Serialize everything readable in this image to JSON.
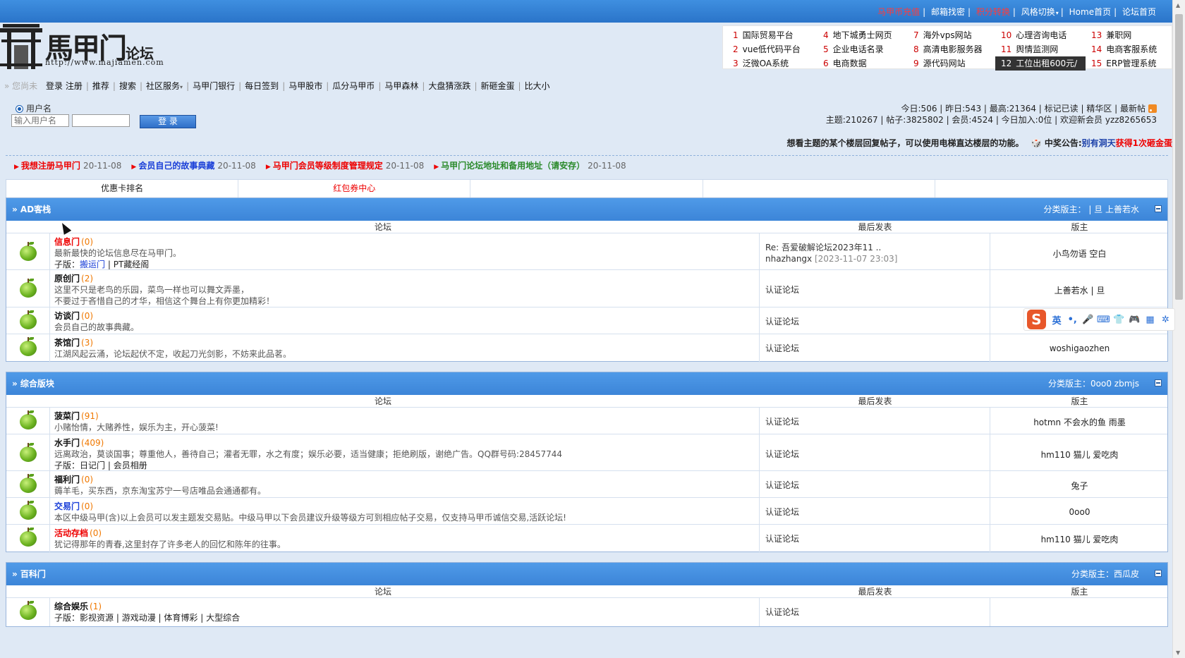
{
  "topbar": {
    "links": [
      "马甲币充值",
      "邮箱找密",
      "积分转换",
      "风格切换",
      "Home首页",
      "论坛首页"
    ]
  },
  "logo": {
    "name": "馬甲门",
    "sub": "论坛",
    "url": "http://www.majiamen.com"
  },
  "ads": [
    {
      "n": "1",
      "label": "国际贸易平台"
    },
    {
      "n": "4",
      "label": "地下城勇士网页"
    },
    {
      "n": "7",
      "label": "海外vps网站"
    },
    {
      "n": "10",
      "label": "心理咨询电话"
    },
    {
      "n": "13",
      "label": "兼职网"
    },
    {
      "n": "2",
      "label": "vue低代码平台"
    },
    {
      "n": "5",
      "label": "企业电话名录"
    },
    {
      "n": "8",
      "label": "高清电影服务器"
    },
    {
      "n": "11",
      "label": "舆情监测网"
    },
    {
      "n": "14",
      "label": "电商客服系统"
    },
    {
      "n": "3",
      "label": "泛微OA系统"
    },
    {
      "n": "6",
      "label": "电商数据"
    },
    {
      "n": "9",
      "label": "源代码网站"
    },
    {
      "n": "12",
      "label": "工位出租600元/"
    },
    {
      "n": "15",
      "label": "ERP管理系统"
    }
  ],
  "nav": {
    "guest": "» 您尚未",
    "items": [
      "登录",
      "注册",
      "推荐",
      "搜索",
      "社区服务",
      "马甲门银行",
      "每日签到",
      "马甲股市",
      "瓜分马甲币",
      "马甲森林",
      "大盘猜涨跌",
      "新砸金蛋",
      "比大小"
    ]
  },
  "login": {
    "radio_label": "用户名",
    "username_placeholder": "输入用户名",
    "button": "登 录"
  },
  "stats": {
    "line1": "今日:506 | 昨日:543 | 最高:21364 | 标记已读 | 精华区 | 最新帖",
    "line2": "主题:210267 | 帖子:3825802 | 会员:4524 | 今日加入:0位 | 欢迎新会员 yzz8265653"
  },
  "notice": {
    "tip": "想看主题的某个楼层回复帖子，可以使用电梯直达楼层的功能。",
    "label": "中奖公告:",
    "name": "别有洞天",
    "text": "获得1次砸金蛋"
  },
  "announcements": [
    {
      "title": "我想注册马甲门",
      "date": "20-11-08",
      "color": "#e00"
    },
    {
      "title": "会员自己的故事典藏",
      "date": "20-11-08",
      "color": "#1a3fd8"
    },
    {
      "title": "马甲门会员等级制度管理规定",
      "date": "20-11-08",
      "color": "#e00"
    },
    {
      "title": "马甲门论坛地址和备用地址（请安存）",
      "date": "20-11-08",
      "color": "#2a8a2a"
    }
  ],
  "quicktabs": [
    "优惠卡排名",
    "红包券中心",
    "",
    "",
    ""
  ],
  "columns": {
    "forum": "论坛",
    "last": "最后发表",
    "mod": "版主"
  },
  "sections": [
    {
      "title": "» AD客栈",
      "mods": "分类版主： | 旦 上善若水",
      "forums": [
        {
          "name": "信息门",
          "count": "(0)",
          "style": "red",
          "desc": "最新最快的论坛信息尽在马甲门。",
          "sub": "子版：",
          "subs": [
            "搬运门",
            "PT藏经阁"
          ],
          "last": "Re: 吾爱破解论坛2023年11 ..",
          "last_user": "nhazhangx",
          "last_date": "[2023-11-07 23:03]",
          "mod": "小鸟勿语 空白"
        },
        {
          "name": "原创门",
          "count": "(2)",
          "style": "",
          "desc": "这里不只是老鸟的乐园，菜鸟一样也可以舞文弄墨，",
          "desc2": "不要过于吝惜自己的才华，相信这个舞台上有你更加精彩！",
          "last": "认证论坛",
          "mod": "上善若水 | 旦"
        },
        {
          "name": "访谈门",
          "count": "(0)",
          "style": "",
          "desc": "会员自己的故事典藏。",
          "last": "认证论坛",
          "mod": "上善若水"
        },
        {
          "name": "茶馆门",
          "count": "(3)",
          "style": "",
          "desc": "江湖风起云涌，论坛起伏不定，收起刀光剑影，不妨来此品茗。",
          "last": "认证论坛",
          "mod": "woshigaozhen"
        }
      ]
    },
    {
      "title": "» 综合版块",
      "mods": "分类版主：0oo0 zbmjs",
      "forums": [
        {
          "name": "菠菜门",
          "count": "(91)",
          "style": "",
          "desc": "小赌怡情，大赌养性，娱乐为主，开心菠菜!",
          "last": "认证论坛",
          "mod": "hotmn 不会水的鱼 雨墨"
        },
        {
          "name": "水手门",
          "count": "(409)",
          "style": "",
          "desc": "远离政治，莫谈国事；尊重他人，善待自己；灌者无罪，水之有度；娱乐必要，适当健康；拒绝刷版，谢绝广告。QQ群号码:28457744",
          "sub": "子版：",
          "subs": [
            "日记门",
            "会员相册"
          ],
          "last": "认证论坛",
          "mod": "hm110 猫儿 爱吃肉"
        },
        {
          "name": "福利门",
          "count": "(0)",
          "style": "",
          "desc": "薅羊毛，买东西，京东淘宝苏宁一号店唯品会通通都有。",
          "last": "认证论坛",
          "mod": "兔子"
        },
        {
          "name": "交易门",
          "count": "(0)",
          "style": "blue",
          "desc": "本区中级马甲(含)以上会员可以发主题发交易贴。中级马甲以下会员建议升级等级方可到相应帖子交易，仅支持马甲币诚信交易,活跃论坛!",
          "last": "认证论坛",
          "mod": "0oo0"
        },
        {
          "name": "活动存档",
          "count": "(0)",
          "style": "red",
          "desc": "犹记得那年的青春,这里封存了许多老人的回忆和陈年的往事。",
          "last": "认证论坛",
          "mod": "hm110 猫儿 爱吃肉"
        }
      ]
    },
    {
      "title": "» 百科门",
      "mods": "分类版主：西瓜皮",
      "forums": [
        {
          "name": "综合娱乐",
          "count": "(1)",
          "style": "",
          "sub": "子版：",
          "subs": [
            "影视资源",
            "游戏动漫",
            "体育博彩",
            "大型综合"
          ],
          "last": "认证论坛",
          "mod": ""
        }
      ]
    }
  ],
  "ime": {
    "logo": "S",
    "icons": [
      "英",
      "•,",
      "🎤",
      "⌨",
      "👕",
      "🎮",
      "▦",
      "✲"
    ]
  }
}
